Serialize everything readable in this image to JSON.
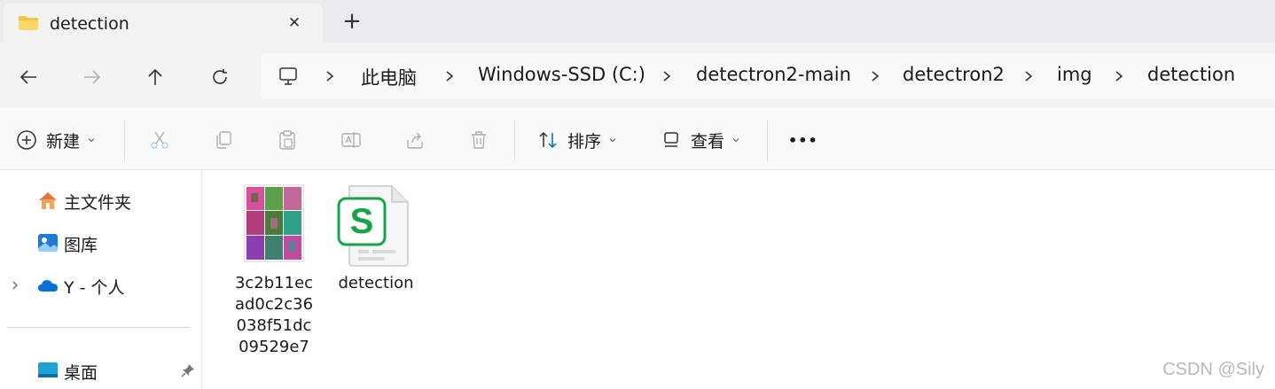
{
  "tabs": [
    {
      "title": "detection",
      "icon": "folder-icon",
      "close_icon": "close-icon"
    }
  ],
  "new_tab_icon": "plus-icon",
  "nav": {
    "back_icon": "arrow-left-icon",
    "forward_icon": "arrow-right-icon",
    "up_icon": "arrow-up-icon",
    "refresh_icon": "refresh-icon"
  },
  "address": {
    "root_icon": "computer-icon",
    "crumbs": [
      "此电脑",
      "Windows-SSD (C:)",
      "detectron2-main",
      "detectron2",
      "img",
      "detection"
    ]
  },
  "toolbar": {
    "new_label": "新建",
    "sort_label": "排序",
    "view_label": "查看",
    "more_label": "•••"
  },
  "sidebar": {
    "items": [
      {
        "label": "主文件夹",
        "icon": "home-icon"
      },
      {
        "label": "图库",
        "icon": "gallery-icon"
      },
      {
        "label": "Y - 个人",
        "icon": "onedrive-cloud-icon"
      },
      {
        "label": "桌面",
        "icon": "desktop-icon"
      }
    ]
  },
  "files": [
    {
      "name": "3c2b11ecad0c2c36038f51dc09529e7",
      "name_lines": [
        "3c2b11ec",
        "ad0c2c36",
        "038f51dc",
        "09529e7"
      ],
      "type": "image"
    },
    {
      "name": "detection",
      "name_lines": [
        "detection"
      ],
      "type": "spreadsheet-document"
    }
  ],
  "watermark": "CSDN @Sily",
  "colors": {
    "accent": "#0067c0",
    "file_green": "#16a34a",
    "onedrive": "#0a6fd6"
  }
}
